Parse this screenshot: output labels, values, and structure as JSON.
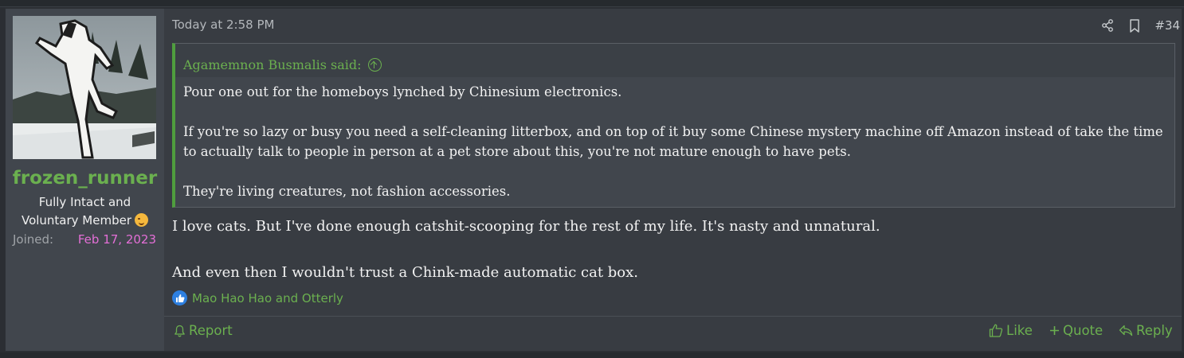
{
  "user": {
    "username": "frozen_runner",
    "title_line1": "Fully Intact and",
    "title_line2": "Voluntary Member",
    "joined_label": "Joined:",
    "joined_value": "Feb 17, 2023"
  },
  "post": {
    "timestamp": "Today at 2:58 PM",
    "number": "#34",
    "quote": {
      "attribution": "Agamemnon Busmalis said:",
      "paragraphs": [
        "Pour one out for the homeboys lynched by Chinesium electronics.",
        "If you're so lazy or busy you need a self-cleaning litterbox, and on top of it buy some Chinese mystery machine off Amazon instead of take the time to actually talk to people in person at a pet store about this, you're not mature enough to have pets.",
        "They're living creatures, not fashion accessories."
      ]
    },
    "message": [
      "I love cats. But I've done enough catshit-scooping for the rest of my life. It's nasty and unnatural.",
      "And even then I wouldn't trust a Chink-made automatic cat box."
    ],
    "reactions": "Mao Hao Hao and Otterly"
  },
  "actions": {
    "report": "Report",
    "like": "Like",
    "quote": "Quote",
    "reply": "Reply"
  },
  "colors": {
    "accent_green": "#6bb04f",
    "joined_pink": "#e36fd6",
    "like_blue": "#2d7fe0"
  }
}
